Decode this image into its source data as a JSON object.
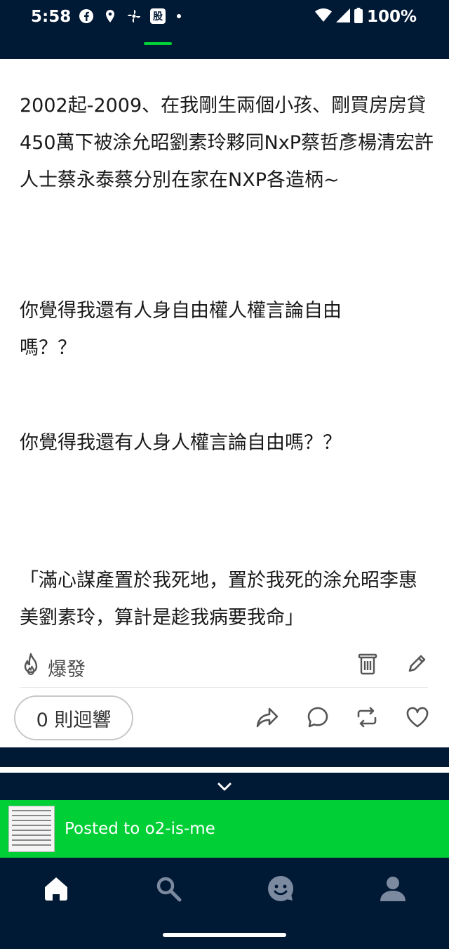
{
  "status_bar": {
    "time": "5:58",
    "battery": "100%",
    "app_badge": "股"
  },
  "post": {
    "paragraphs": [
      "2002起-2009、在我剛生兩個小孩、剛買房房貸450萬下被涂允昭劉素玲夥同NxP蔡哲彥楊清宏許人士蔡永泰蔡分別在家在NXP各造柄~",
      "你覺得我還有人身自由權人權言論自由嗎？？",
      "你覺得我還有人身人權言論自由嗎？？",
      "「滿心謀產置於我死地，置於我死的涂允昭李惠美劉素玲，算計是趁我病要我命」"
    ],
    "boom_label": "爆發",
    "notes_label": "0 則迴響"
  },
  "toast": {
    "text": "Posted to o2-is-me"
  },
  "colors": {
    "navy": "#001935",
    "green": "#00cf35",
    "white": "#ffffff"
  },
  "icons": [
    "flame-icon",
    "trash-icon",
    "pencil-icon",
    "share-icon",
    "reply-icon",
    "reblog-icon",
    "like-icon",
    "chevron-down-icon",
    "home-icon",
    "search-icon",
    "activity-face-icon",
    "account-icon"
  ]
}
